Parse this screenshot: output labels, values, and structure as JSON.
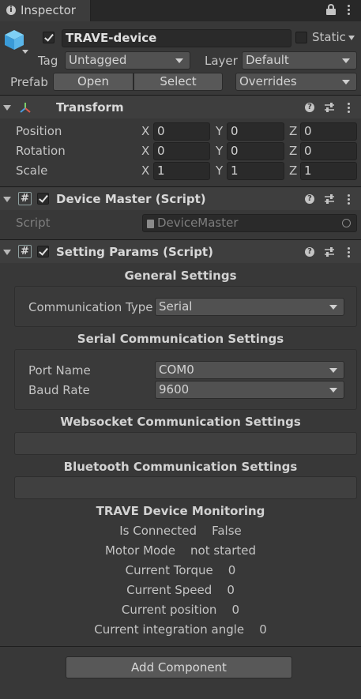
{
  "tab": {
    "title": "Inspector"
  },
  "object": {
    "name": "TRAVE-device",
    "static_label": "Static",
    "tag_label": "Tag",
    "tag_value": "Untagged",
    "layer_label": "Layer",
    "layer_value": "Default",
    "prefab_label": "Prefab",
    "open_label": "Open",
    "select_label": "Select",
    "overrides_label": "Overrides"
  },
  "transform": {
    "title": "Transform",
    "rows": [
      {
        "label": "Position",
        "x": "0",
        "y": "0",
        "z": "0"
      },
      {
        "label": "Rotation",
        "x": "0",
        "y": "0",
        "z": "0"
      },
      {
        "label": "Scale",
        "x": "1",
        "y": "1",
        "z": "1"
      }
    ],
    "axis_x": "X",
    "axis_y": "Y",
    "axis_z": "Z"
  },
  "device_master": {
    "title": "Device Master (Script)",
    "script_label": "Script",
    "script_value": "DeviceMaster"
  },
  "setting_params": {
    "title": "Setting Params (Script)",
    "general_title": "General Settings",
    "comm_type_label": "Communication Type",
    "comm_type_value": "Serial",
    "serial_title": "Serial Communication Settings",
    "port_label": "Port Name",
    "port_value": "COM0",
    "baud_label": "Baud Rate",
    "baud_value": "9600",
    "websocket_title": "Websocket Communication Settings",
    "bluetooth_title": "Bluetooth Communication Settings",
    "monitoring_title": "TRAVE Device Monitoring",
    "monitoring": [
      "Is Connected    False",
      "Motor Mode    not started",
      "Current Torque    0",
      "Current Speed    0",
      "Current position    0",
      "Current integration angle    0"
    ]
  },
  "add_component": "Add Component"
}
